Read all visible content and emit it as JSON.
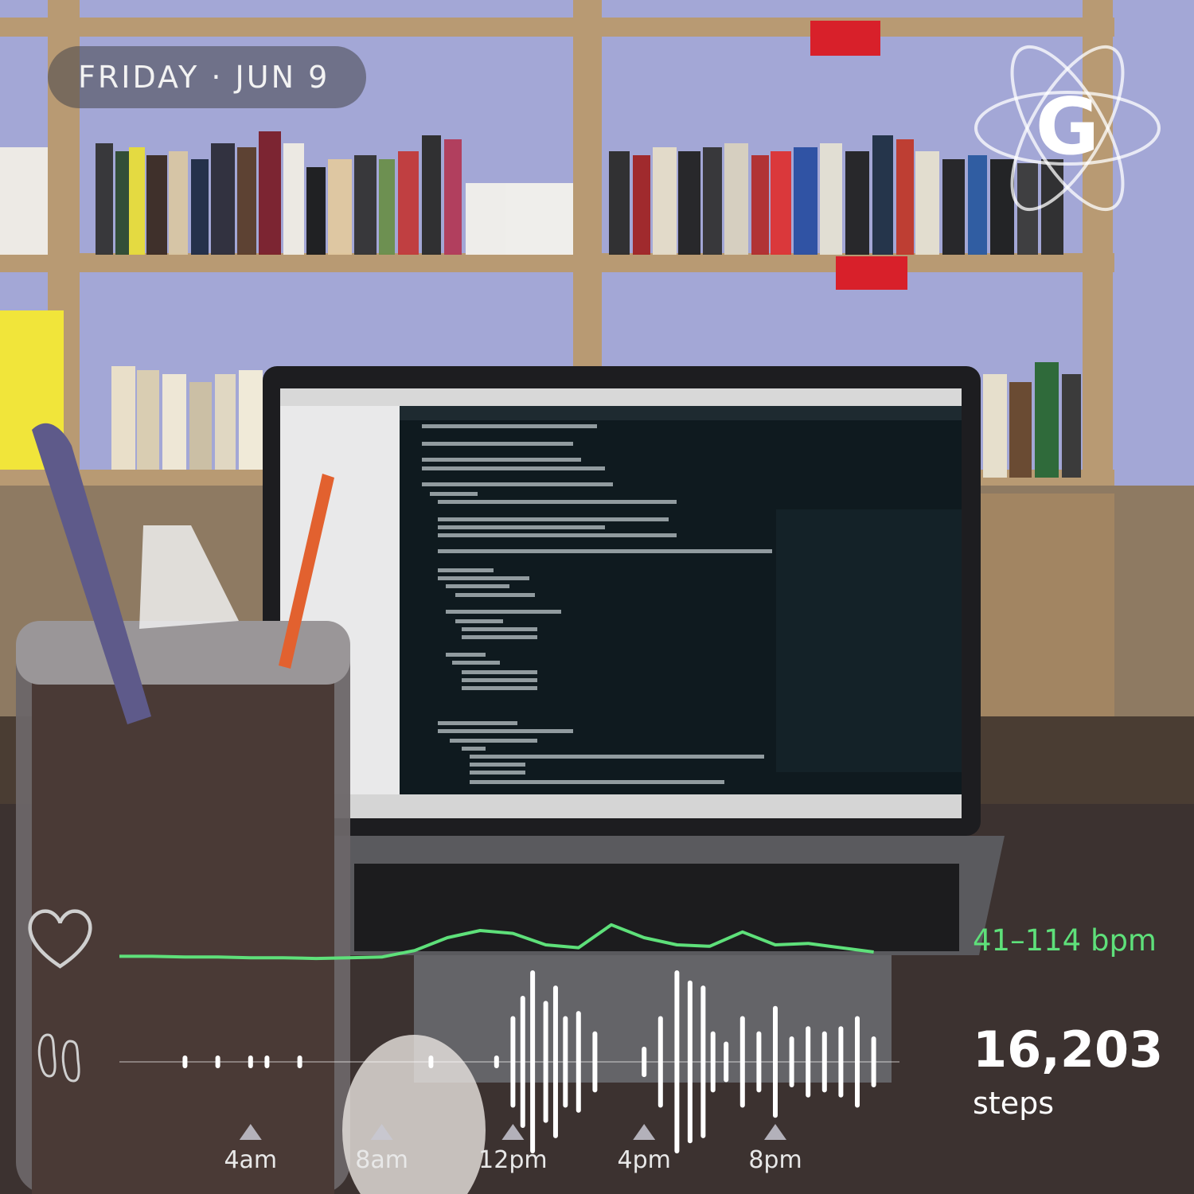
{
  "date_label": "FRIDAY · JUN 9",
  "logo": {
    "letter": "G",
    "icon": "atom-orbit-logo"
  },
  "heart_rate": {
    "label": "41–114 bpm",
    "icon": "heart-outline-icon",
    "color": "#5ee07a"
  },
  "steps": {
    "value": "16,203",
    "unit": "steps",
    "icon": "footprints-icon"
  },
  "time_axis": {
    "labels": [
      "4am",
      "8am",
      "12pm",
      "4pm",
      "8pm"
    ]
  },
  "chart_data": {
    "type": "line",
    "title": "",
    "x_unit": "hour of day",
    "heart_rate_series": {
      "x": [
        0,
        1,
        2,
        3,
        4,
        5,
        6,
        7,
        8,
        9,
        10,
        11,
        12,
        13,
        14,
        15,
        16,
        17,
        18,
        19,
        20,
        21,
        22,
        23
      ],
      "y": [
        44,
        44,
        43,
        43,
        42,
        42,
        41,
        42,
        43,
        52,
        70,
        80,
        76,
        60,
        56,
        88,
        70,
        60,
        58,
        78,
        60,
        62,
        56,
        50
      ]
    },
    "steps_series": {
      "x": [
        2,
        3,
        4,
        4.5,
        5.5,
        9.5,
        11.5,
        12,
        12.3,
        12.6,
        13,
        13.3,
        13.6,
        14,
        14.5,
        16,
        16.5,
        17,
        17.4,
        17.8,
        18.1,
        18.5,
        19,
        19.5,
        20,
        20.5,
        21,
        21.5,
        22,
        22.5,
        23
      ],
      "y": [
        30,
        50,
        30,
        70,
        40,
        30,
        60,
        900,
        1300,
        1800,
        1200,
        1500,
        900,
        1000,
        600,
        300,
        900,
        1800,
        1600,
        1500,
        600,
        400,
        900,
        600,
        1100,
        500,
        700,
        600,
        700,
        900,
        500
      ]
    }
  }
}
